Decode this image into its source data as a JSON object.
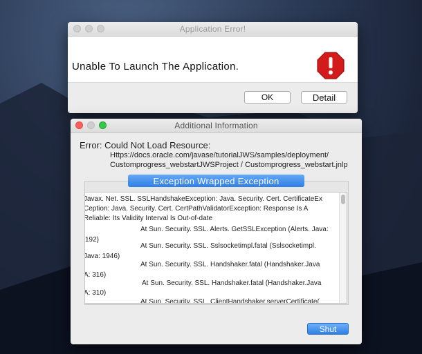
{
  "error_dialog": {
    "title": "Application Error!",
    "message": "Unable To Launch The Application.",
    "ok_label": "OK",
    "detail_label": "Detail",
    "icon": "stop-icon"
  },
  "info_dialog": {
    "title": "Additional Information",
    "error_label": "Error: Could Not Load Resource:",
    "url_line1": "Https://docs.oracle.com/javase/tutorialJWS/samples/deployment/",
    "url_line2": "Customprogress_webstartJWSProject / Customprogress_webstart.jnlp",
    "tab_label": "Exception Wrapped Exception",
    "shut_label": "Shut",
    "trace_lines": [
      "Javax. Net. SSL. SSLHandshakeException: Java. Security. Cert. CertificateEx",
      "Ception: Java. Security. Cert. CertPathValidatorException: Response Is A",
      "Reliable: Its Validity Interval Is Out-of-date",
      "At Sun. Security. SSL. Alerts. GetSSLException (Alerts. Java:",
      "192)",
      "At Sun. Security. SSL. Sslsocketimpl.fatal (Sslsocketimpl.",
      "Java: 1946)",
      "At Sun. Security. SSL. Handshaker.fatal (Handshaker.Java",
      "A: 316)",
      "At Sun. Security. SSL. Handshaker.fatal (Handshaker.Java",
      "A: 310)",
      "At Sun. Security. SSL. ClientHandshaker.serverCertificate("
    ]
  },
  "colors": {
    "accent_blue": "#2f7fe6",
    "close_red": "#fc605c",
    "minimize_gray": "#cfcfcf",
    "zoom_green": "#34c84a",
    "stop_red": "#d41b1b"
  }
}
